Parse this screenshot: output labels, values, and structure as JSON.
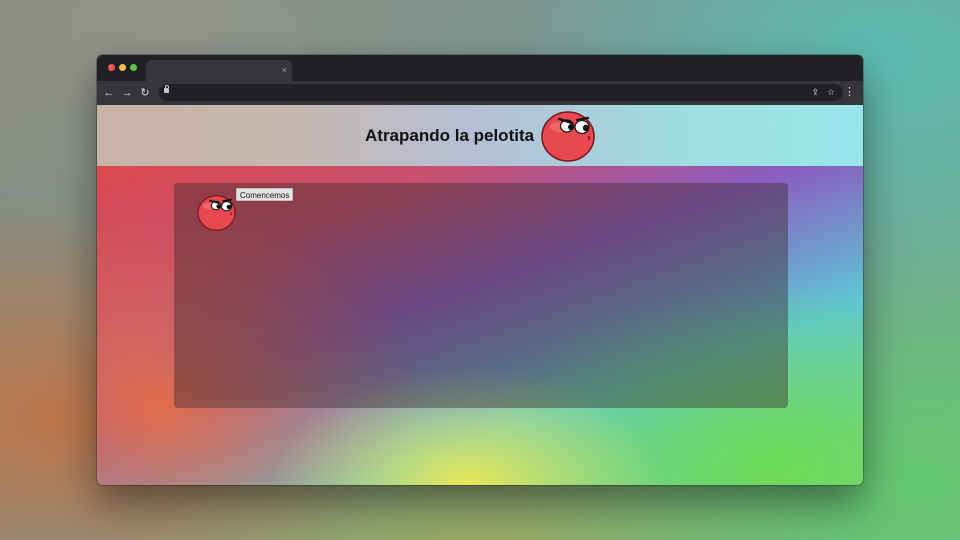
{
  "browser": {
    "tab_title": "",
    "tab_close_glyph": "×",
    "address": "",
    "traffic_lights": {
      "close": "#ee5a52",
      "minimize": "#f5bd4f",
      "zoom": "#5fc454"
    },
    "nav": {
      "back_glyph": "←",
      "forward_glyph": "→",
      "reload_glyph": "↻",
      "share_glyph": "⇪",
      "bookmark_glyph": "☆",
      "menu_glyph": "⋮"
    }
  },
  "page": {
    "title": "Atrapando la pelotita",
    "start_button_label": "Comencemos"
  },
  "icons": {
    "header_ball": "red-ball-icon",
    "game_ball": "red-ball-icon"
  },
  "colors": {
    "ball_red": "#e8484f",
    "ball_outline": "#7a1a1e"
  }
}
